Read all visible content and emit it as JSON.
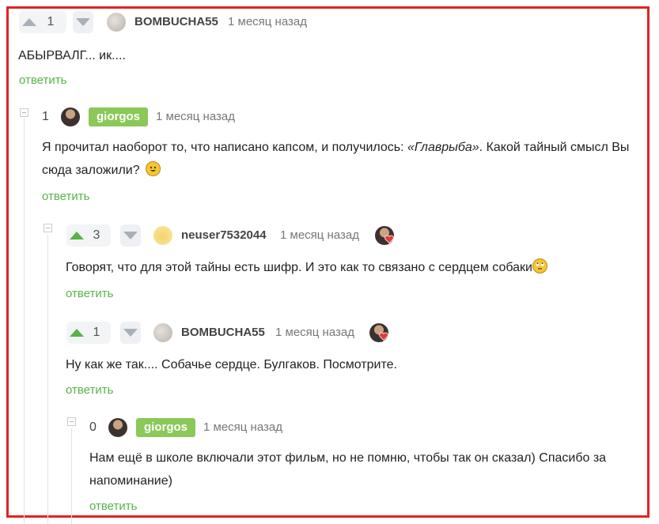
{
  "comments": [
    {
      "votes": "1",
      "user": "BOMBUCHA55",
      "time": "1 месяц назад",
      "text": "АБЫРВАЛГ... ик....",
      "reply": "ответить"
    },
    {
      "votes": "1",
      "user": "giorgos",
      "time": "1 месяц назад",
      "text_before": "Я прочитал наоборот то, что написано капсом, и получилось: ",
      "text_italic": "«Главрыба»",
      "text_after": ". Какой тайный смысл Вы сюда заложили?",
      "reply": "ответить"
    },
    {
      "votes": "3",
      "user": "neuser7532044",
      "time": "1 месяц назад",
      "text": "Говорят, что для этой тайны есть шифр. И это как то связано с сердцем собаки",
      "reply": "ответить"
    },
    {
      "votes": "1",
      "user": "BOMBUCHA55",
      "time": "1 месяц назад",
      "text": "Ну как же так.... Собачье сердце. Булгаков. Посмотрите.",
      "reply": "ответить"
    },
    {
      "votes": "0",
      "user": "giorgos",
      "time": "1 месяц назад",
      "text": "Нам ещё в школе включали этот фильм, но не помню, чтобы так он сказал) Спасибо за напоминание)",
      "reply": "ответить"
    }
  ],
  "icons": {
    "upvote": "triangle-up",
    "downvote": "triangle-down",
    "collapse": "minus-box",
    "heart": "heart"
  },
  "colors": {
    "accent": "#57b34a",
    "badge": "#8ac858",
    "frame": "#e32222"
  }
}
